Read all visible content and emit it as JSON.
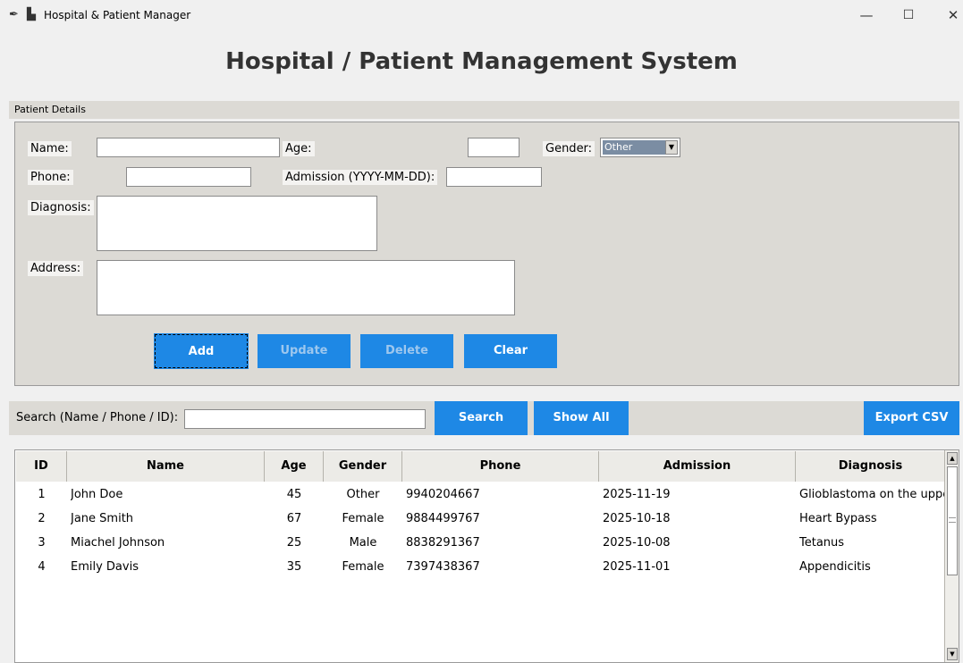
{
  "titlebar": {
    "title": "Hospital & Patient Manager",
    "feather_icon": "feather-icon",
    "app_icon": "app-icon",
    "minimize": "—",
    "maximize": "☐",
    "close": "✕"
  },
  "heading": "Hospital / Patient Management System",
  "details": {
    "group_label": "Patient Details",
    "name_label": "Name:",
    "age_label": "Age:",
    "gender_label": "Gender:",
    "gender_value": "Other",
    "phone_label": "Phone:",
    "admission_label": "Admission (YYYY-MM-DD):",
    "diagnosis_label": "Diagnosis:",
    "address_label": "Address:",
    "name_value": "",
    "age_value": "",
    "phone_value": "",
    "admission_value": "",
    "diagnosis_value": "",
    "address_value": ""
  },
  "actions": {
    "add": "Add",
    "update": "Update",
    "delete": "Delete",
    "clear": "Clear"
  },
  "search": {
    "label": "Search (Name / Phone / ID):",
    "value": "",
    "search_button": "Search",
    "show_all_button": "Show All",
    "export_button": "Export CSV"
  },
  "table": {
    "columns": [
      "ID",
      "Name",
      "Age",
      "Gender",
      "Phone",
      "Admission",
      "Diagnosis"
    ],
    "rows": [
      {
        "id": "1",
        "name": "John Doe",
        "age": "45",
        "gender": "Other",
        "phone": "9940204667",
        "admission": "2025-11-19",
        "diagnosis": "Glioblastoma on the uppe"
      },
      {
        "id": "2",
        "name": "Jane Smith",
        "age": "67",
        "gender": "Female",
        "phone": "9884499767",
        "admission": "2025-10-18",
        "diagnosis": "Heart Bypass"
      },
      {
        "id": "3",
        "name": "Miachel Johnson",
        "age": "25",
        "gender": "Male",
        "phone": "8838291367",
        "admission": "2025-10-08",
        "diagnosis": "Tetanus"
      },
      {
        "id": "4",
        "name": "Emily Davis",
        "age": "35",
        "gender": "Female",
        "phone": "7397438367",
        "admission": "2025-11-01",
        "diagnosis": "Appendicitis"
      }
    ]
  },
  "colors": {
    "accent": "#1e88e5",
    "panel": "#dcdad5"
  }
}
